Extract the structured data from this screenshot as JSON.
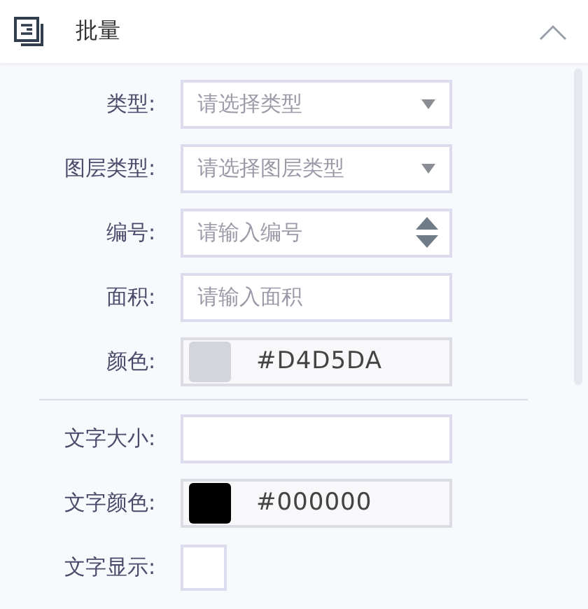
{
  "panel": {
    "title": "批量",
    "expanded": true
  },
  "groups": [
    {
      "fields": [
        {
          "kind": "select",
          "label": "类型:",
          "placeholder": "请选择类型"
        },
        {
          "kind": "select",
          "label": "图层类型:",
          "placeholder": "请选择图层类型"
        },
        {
          "kind": "number",
          "label": "编号:",
          "placeholder": "请输入编号"
        },
        {
          "kind": "text",
          "label": "面积:",
          "placeholder": "请输入面积"
        },
        {
          "kind": "color",
          "label": "颜色:",
          "value": "#D4D5DA",
          "color": "#d4d5da"
        }
      ]
    },
    {
      "fields": [
        {
          "kind": "text",
          "label": "文字大小:"
        },
        {
          "kind": "color",
          "label": "文字颜色:",
          "value": "#000000",
          "color": "#000000"
        },
        {
          "kind": "checkbox",
          "label": "文字显示:",
          "checked": false
        }
      ]
    }
  ]
}
